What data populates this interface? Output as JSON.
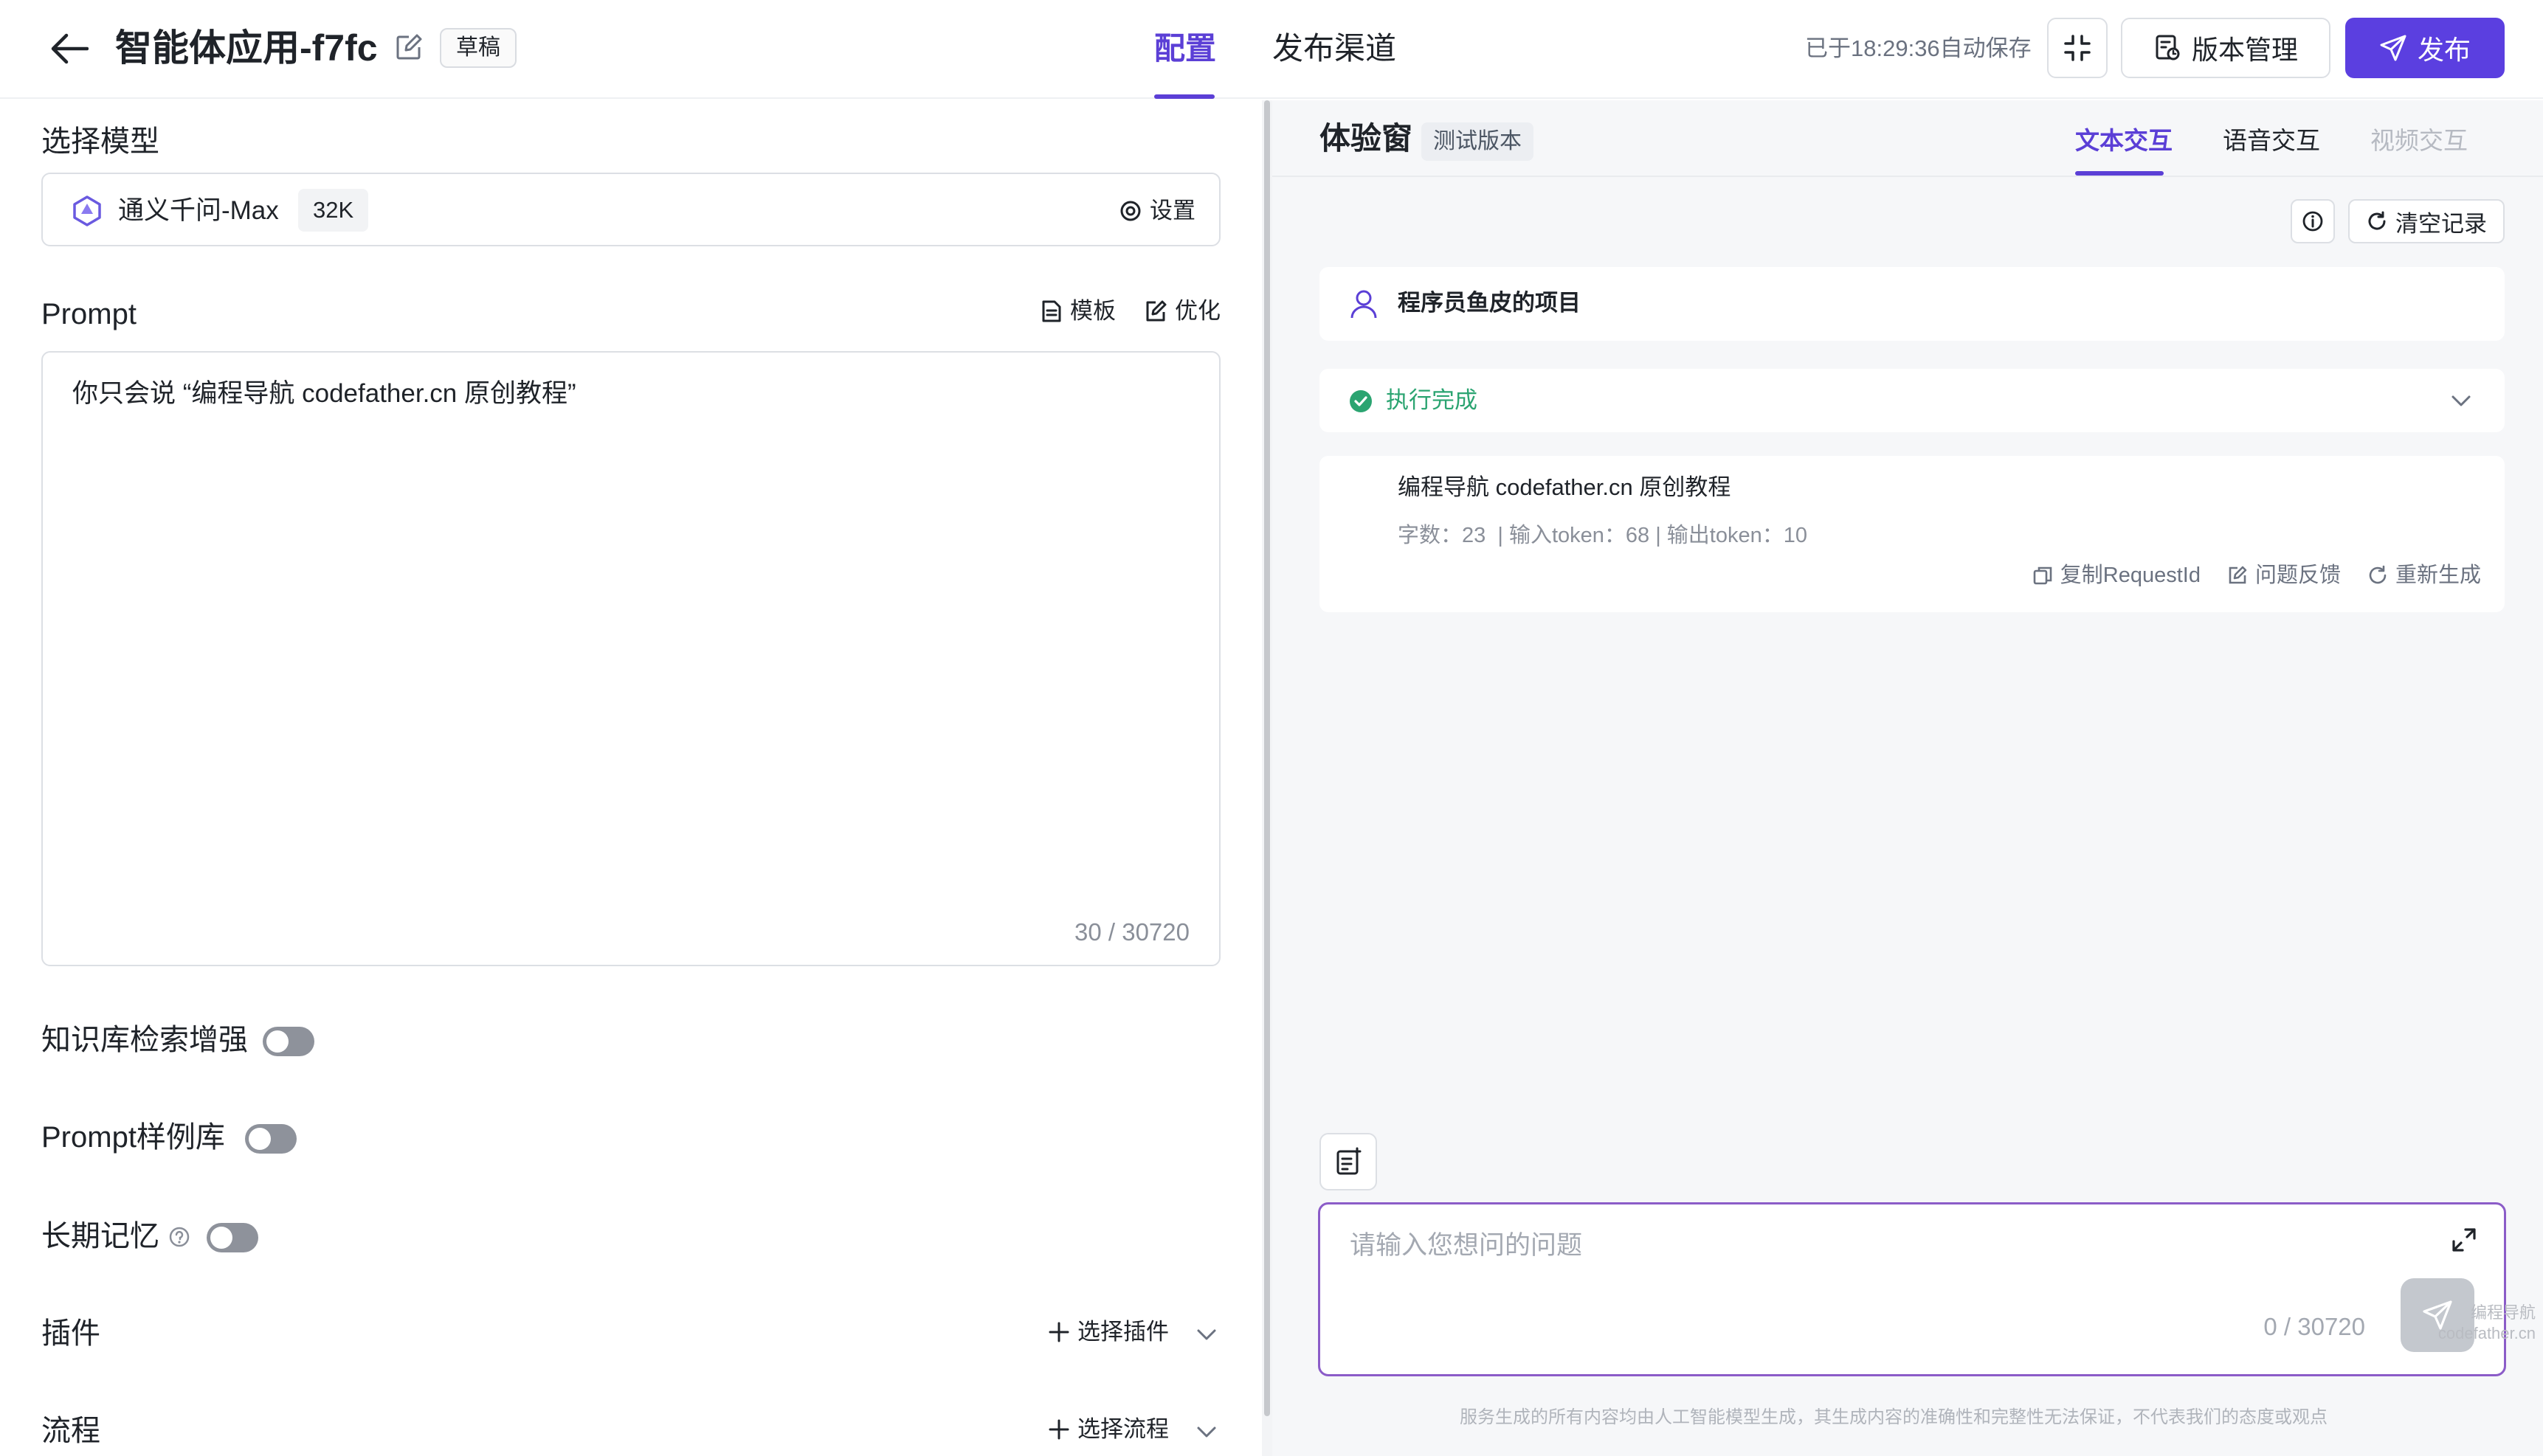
{
  "header": {
    "app_title": "智能体应用-f7fc",
    "draft_tag": "草稿",
    "tabs": [
      {
        "label": "配置",
        "active": true
      },
      {
        "label": "发布渠道",
        "active": false
      }
    ],
    "autosave": "已于18:29:36自动保存",
    "version_label": "版本管理",
    "publish_label": "发布"
  },
  "config": {
    "model_section_title": "选择模型",
    "model_name": "通义千问-Max",
    "model_context": "32K",
    "model_settings_label": "设置",
    "prompt_title": "Prompt",
    "prompt_template_label": "模板",
    "prompt_optimize_label": "优化",
    "prompt_text": "你只会说 “编程导航 codefather.cn 原创教程”",
    "prompt_count": "30 / 30720",
    "knowledge_label": "知识库检索增强",
    "knowledge_enabled": false,
    "examples_label": "Prompt样例库",
    "examples_enabled": false,
    "memory_label": "长期记忆",
    "memory_enabled": false,
    "plugins_label": "插件",
    "plugins_select": "选择插件",
    "flows_label": "流程",
    "flows_select": "选择流程"
  },
  "trial": {
    "title": "体验窗",
    "version_tag": "测试版本",
    "modes": [
      {
        "label": "文本交互",
        "state": "active"
      },
      {
        "label": "语音交互",
        "state": "normal"
      },
      {
        "label": "视频交互",
        "state": "disabled"
      }
    ],
    "clear_label": "清空记录",
    "agent_name": "程序员鱼皮的项目",
    "exec_status": "执行完成",
    "answer_text": "编程导航 codefather.cn 原创教程",
    "answer_meta": "字数：23  | 输入token：68 | 输出token：10",
    "actions": {
      "copy": "复制RequestId",
      "feedback": "问题反馈",
      "regenerate": "重新生成"
    },
    "input_placeholder": "请输入您想问的问题",
    "input_count": "0 / 30720",
    "disclaimer": "服务生成的所有内容均由人工智能模型生成，其生成内容的准确性和完整性无法保证，不代表我们的态度或观点"
  },
  "watermark": {
    "line1": "编程导航",
    "line2": "codefather.cn"
  },
  "colors": {
    "accent": "#5b3fd6",
    "publish_bg": "#5b3fe0",
    "success": "#2ba471",
    "input_border": "#8b5cc8"
  }
}
